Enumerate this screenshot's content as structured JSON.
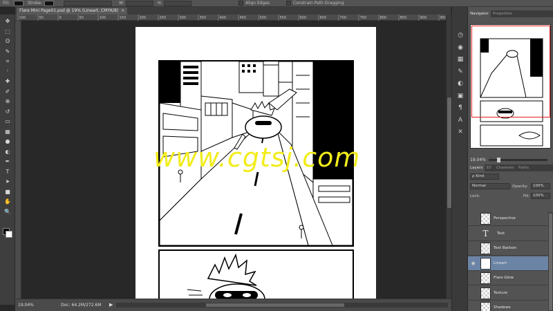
{
  "options_bar": {
    "fields": [
      "Fill:",
      "Stroke:",
      "W:",
      "H:"
    ],
    "align_edges_label": "Align Edges",
    "constrain_label": "Constrain Path Dragging"
  },
  "document_tab": {
    "title": "Flare Mini Page01.psd @ 19% (Lineart, CMYK/8)",
    "close": "×"
  },
  "ruler": {
    "ticks": [
      "100",
      "50",
      "0",
      "50",
      "100",
      "150",
      "200",
      "250",
      "300",
      "350",
      "400",
      "450",
      "500",
      "550",
      "600",
      "650",
      "700",
      "750",
      "800",
      "850",
      "900",
      "950"
    ]
  },
  "toolbox": {
    "icons": [
      "move-icon",
      "marquee-icon",
      "lasso-icon",
      "quick-select-icon",
      "crop-icon",
      "eyedropper-icon",
      "healing-brush-icon",
      "brush-icon",
      "clone-stamp-icon",
      "history-brush-icon",
      "eraser-icon",
      "gradient-icon",
      "blur-icon",
      "dodge-icon",
      "pen-icon",
      "type-icon",
      "path-select-icon",
      "shape-icon",
      "hand-icon",
      "zoom-icon"
    ],
    "glyphs": [
      "✥",
      "⬚",
      "ʘ",
      "✎",
      "⌗",
      "ⁱ",
      "✚",
      "✐",
      "⊕",
      "↺",
      "▭",
      "▦",
      "●",
      "◐",
      "✒",
      "T",
      "➤",
      "■",
      "✋",
      "🔍"
    ]
  },
  "watermark": "www.cgtsj.com",
  "status_bar": {
    "zoom": "19.04%",
    "doc": "Doc: 64.2M/272.6M",
    "arrow": "▶"
  },
  "icon_strip": {
    "icons": [
      "history-icon",
      "color-icon",
      "swatches-icon",
      "brush-preset-icon",
      "adjustments-icon",
      "styles-icon",
      "paragraph-icon",
      "character-icon",
      "transform-icon"
    ],
    "glyphs": [
      "◷",
      "◉",
      "▦",
      "✎",
      "◐",
      "▣",
      "¶",
      "A",
      "✕"
    ]
  },
  "navigator": {
    "tabs": [
      "Navigator",
      "Properties"
    ],
    "zoom": "19.04%"
  },
  "layers_panel": {
    "tabs": [
      "Layers",
      "3D",
      "Channels",
      "Paths"
    ],
    "kind_label": "ρ Kind",
    "blend_mode": "Normal",
    "opacity_label": "Opacity:",
    "opacity_value": "100%",
    "lock_label": "Lock:",
    "fill_label": "Fill:",
    "fill_value": "100%",
    "layers": [
      {
        "name": "Perspective",
        "type": "pixel",
        "visible": false,
        "selected": false
      },
      {
        "name": "Text",
        "type": "text",
        "visible": false,
        "selected": false
      },
      {
        "name": "Text Balloon",
        "type": "pixel",
        "visible": false,
        "selected": false
      },
      {
        "name": "Lineart",
        "type": "art",
        "visible": true,
        "selected": true
      },
      {
        "name": "Flare Glow",
        "type": "pixel",
        "visible": false,
        "selected": false
      },
      {
        "name": "Texture",
        "type": "pixel",
        "visible": false,
        "selected": false
      },
      {
        "name": "Shadows",
        "type": "pixel",
        "visible": false,
        "selected": false
      }
    ]
  }
}
